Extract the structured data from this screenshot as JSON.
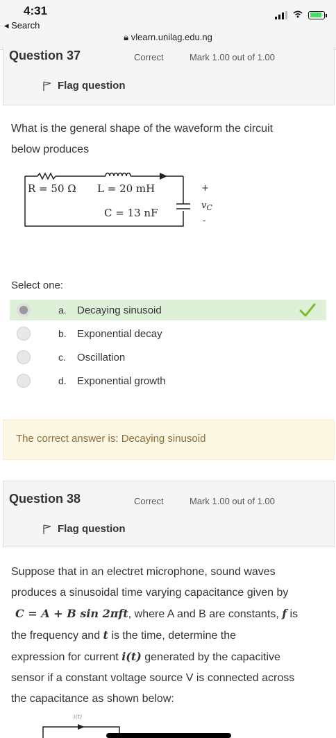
{
  "status_bar": {
    "time": "4:31",
    "back_label": "◂ Search",
    "url": "vlearn.unilag.edu.ng"
  },
  "q37": {
    "title": "Question 37",
    "state": "Correct",
    "mark": "Mark 1.00 out of 1.00",
    "flag_label": "Flag question",
    "text_line1": "What is the general shape of the waveform the circuit",
    "text_line2": "below produces",
    "circuit": {
      "resistor": "R = 50 Ω",
      "inductor": "L = 20 mH",
      "capacitor": "C = 13 nF",
      "plus": "+",
      "minus": "-",
      "vc": "v",
      "vc_sub": "C"
    },
    "select_label": "Select one:",
    "options": [
      {
        "letter": "a.",
        "label": "Decaying sinusoid",
        "checked": true,
        "correct": true
      },
      {
        "letter": "b.",
        "label": "Exponential decay",
        "checked": false,
        "correct": false
      },
      {
        "letter": "c.",
        "label": "Oscillation",
        "checked": false,
        "correct": false
      },
      {
        "letter": "d.",
        "label": "Exponential growth",
        "checked": false,
        "correct": false
      }
    ],
    "feedback": "The correct answer is: Decaying sinusoid"
  },
  "q38": {
    "title": "Question 38",
    "state": "Correct",
    "mark": "Mark 1.00 out of 1.00",
    "flag_label": "Flag question",
    "text_line1": "Suppose that in an electret microphone, sound waves",
    "text_line2": "produces a sinusoidal time varying capacitance given by",
    "formula": "C = A + B sin 2πft",
    "text_line3_rest": ", where A and B are constants, ",
    "f_var": "f",
    "text_line3_end": " is",
    "text_line4_start": "the frequency and ",
    "t_var": "t",
    "text_line4_end": " is the time, determine the",
    "text_line5_start": "expression for current ",
    "current_expr": "i(t)",
    "text_line5_end": " generated by the capacitive",
    "text_line6": "sensor if a constant voltage source V is connected across",
    "text_line7": "the capacitance as shown below:",
    "diagram_label": "i(t)"
  },
  "colors": {
    "correct_bg": "#dff0d8",
    "feedback_bg": "#fcf8e3",
    "check_green": "#7cbd2f"
  }
}
